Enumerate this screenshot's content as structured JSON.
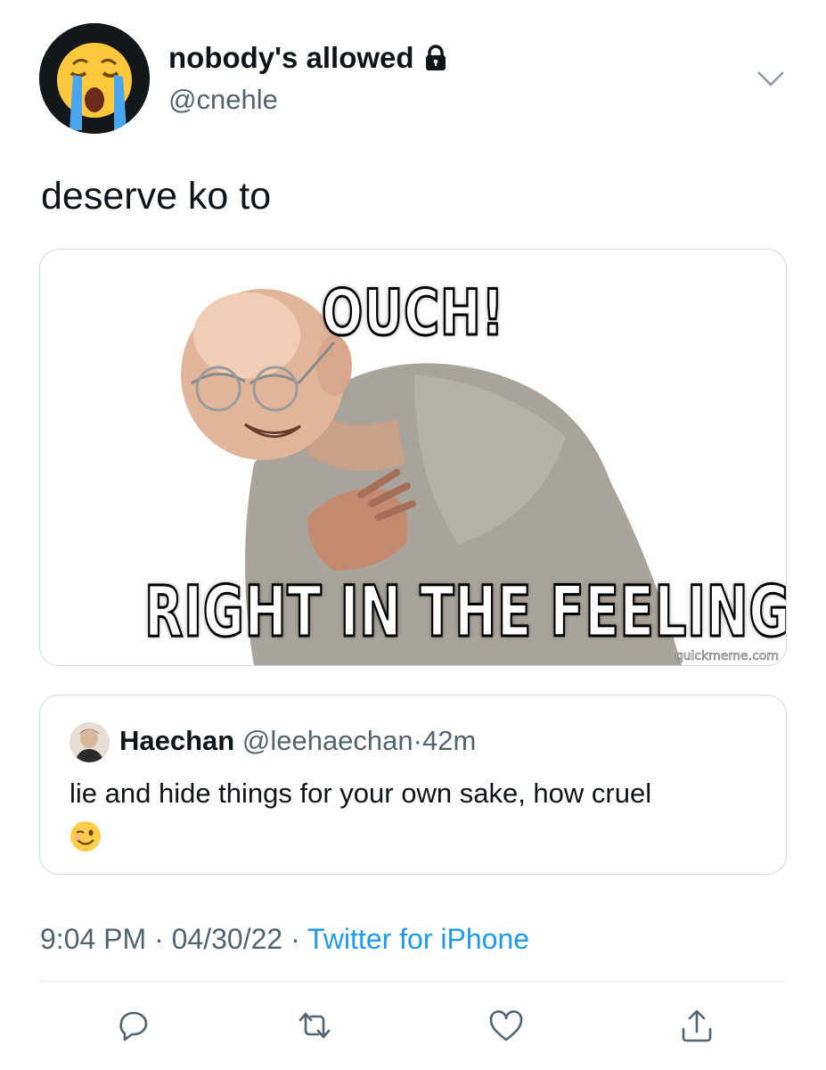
{
  "author": {
    "display_name": "nobody's allowed",
    "handle": "@cnehle",
    "avatar_icon": "loudly-crying-face-emoji",
    "protected_icon": "lock-icon"
  },
  "tweet": {
    "text": "deserve ko to"
  },
  "media": {
    "top_caption": "OUCH!",
    "bottom_caption": "RIGHT IN THE FEELINGS",
    "watermark": "quickmeme.com"
  },
  "quoted_tweet": {
    "display_name": "Haechan",
    "handle": "@leehaechan",
    "separator": "·",
    "time": "42m",
    "text": "lie and hide things for your own sake, how cruel",
    "emoji": "winking-face-emoji"
  },
  "meta": {
    "time": "9:04 PM",
    "separator": "·",
    "date": "04/30/22",
    "source": "Twitter for iPhone"
  },
  "actions": [
    "reply-icon",
    "retweet-icon",
    "like-icon",
    "share-icon"
  ],
  "colors": {
    "text": "#0f1419",
    "secondary": "#536471",
    "link": "#1d9bf0",
    "border": "#cfd9de"
  }
}
